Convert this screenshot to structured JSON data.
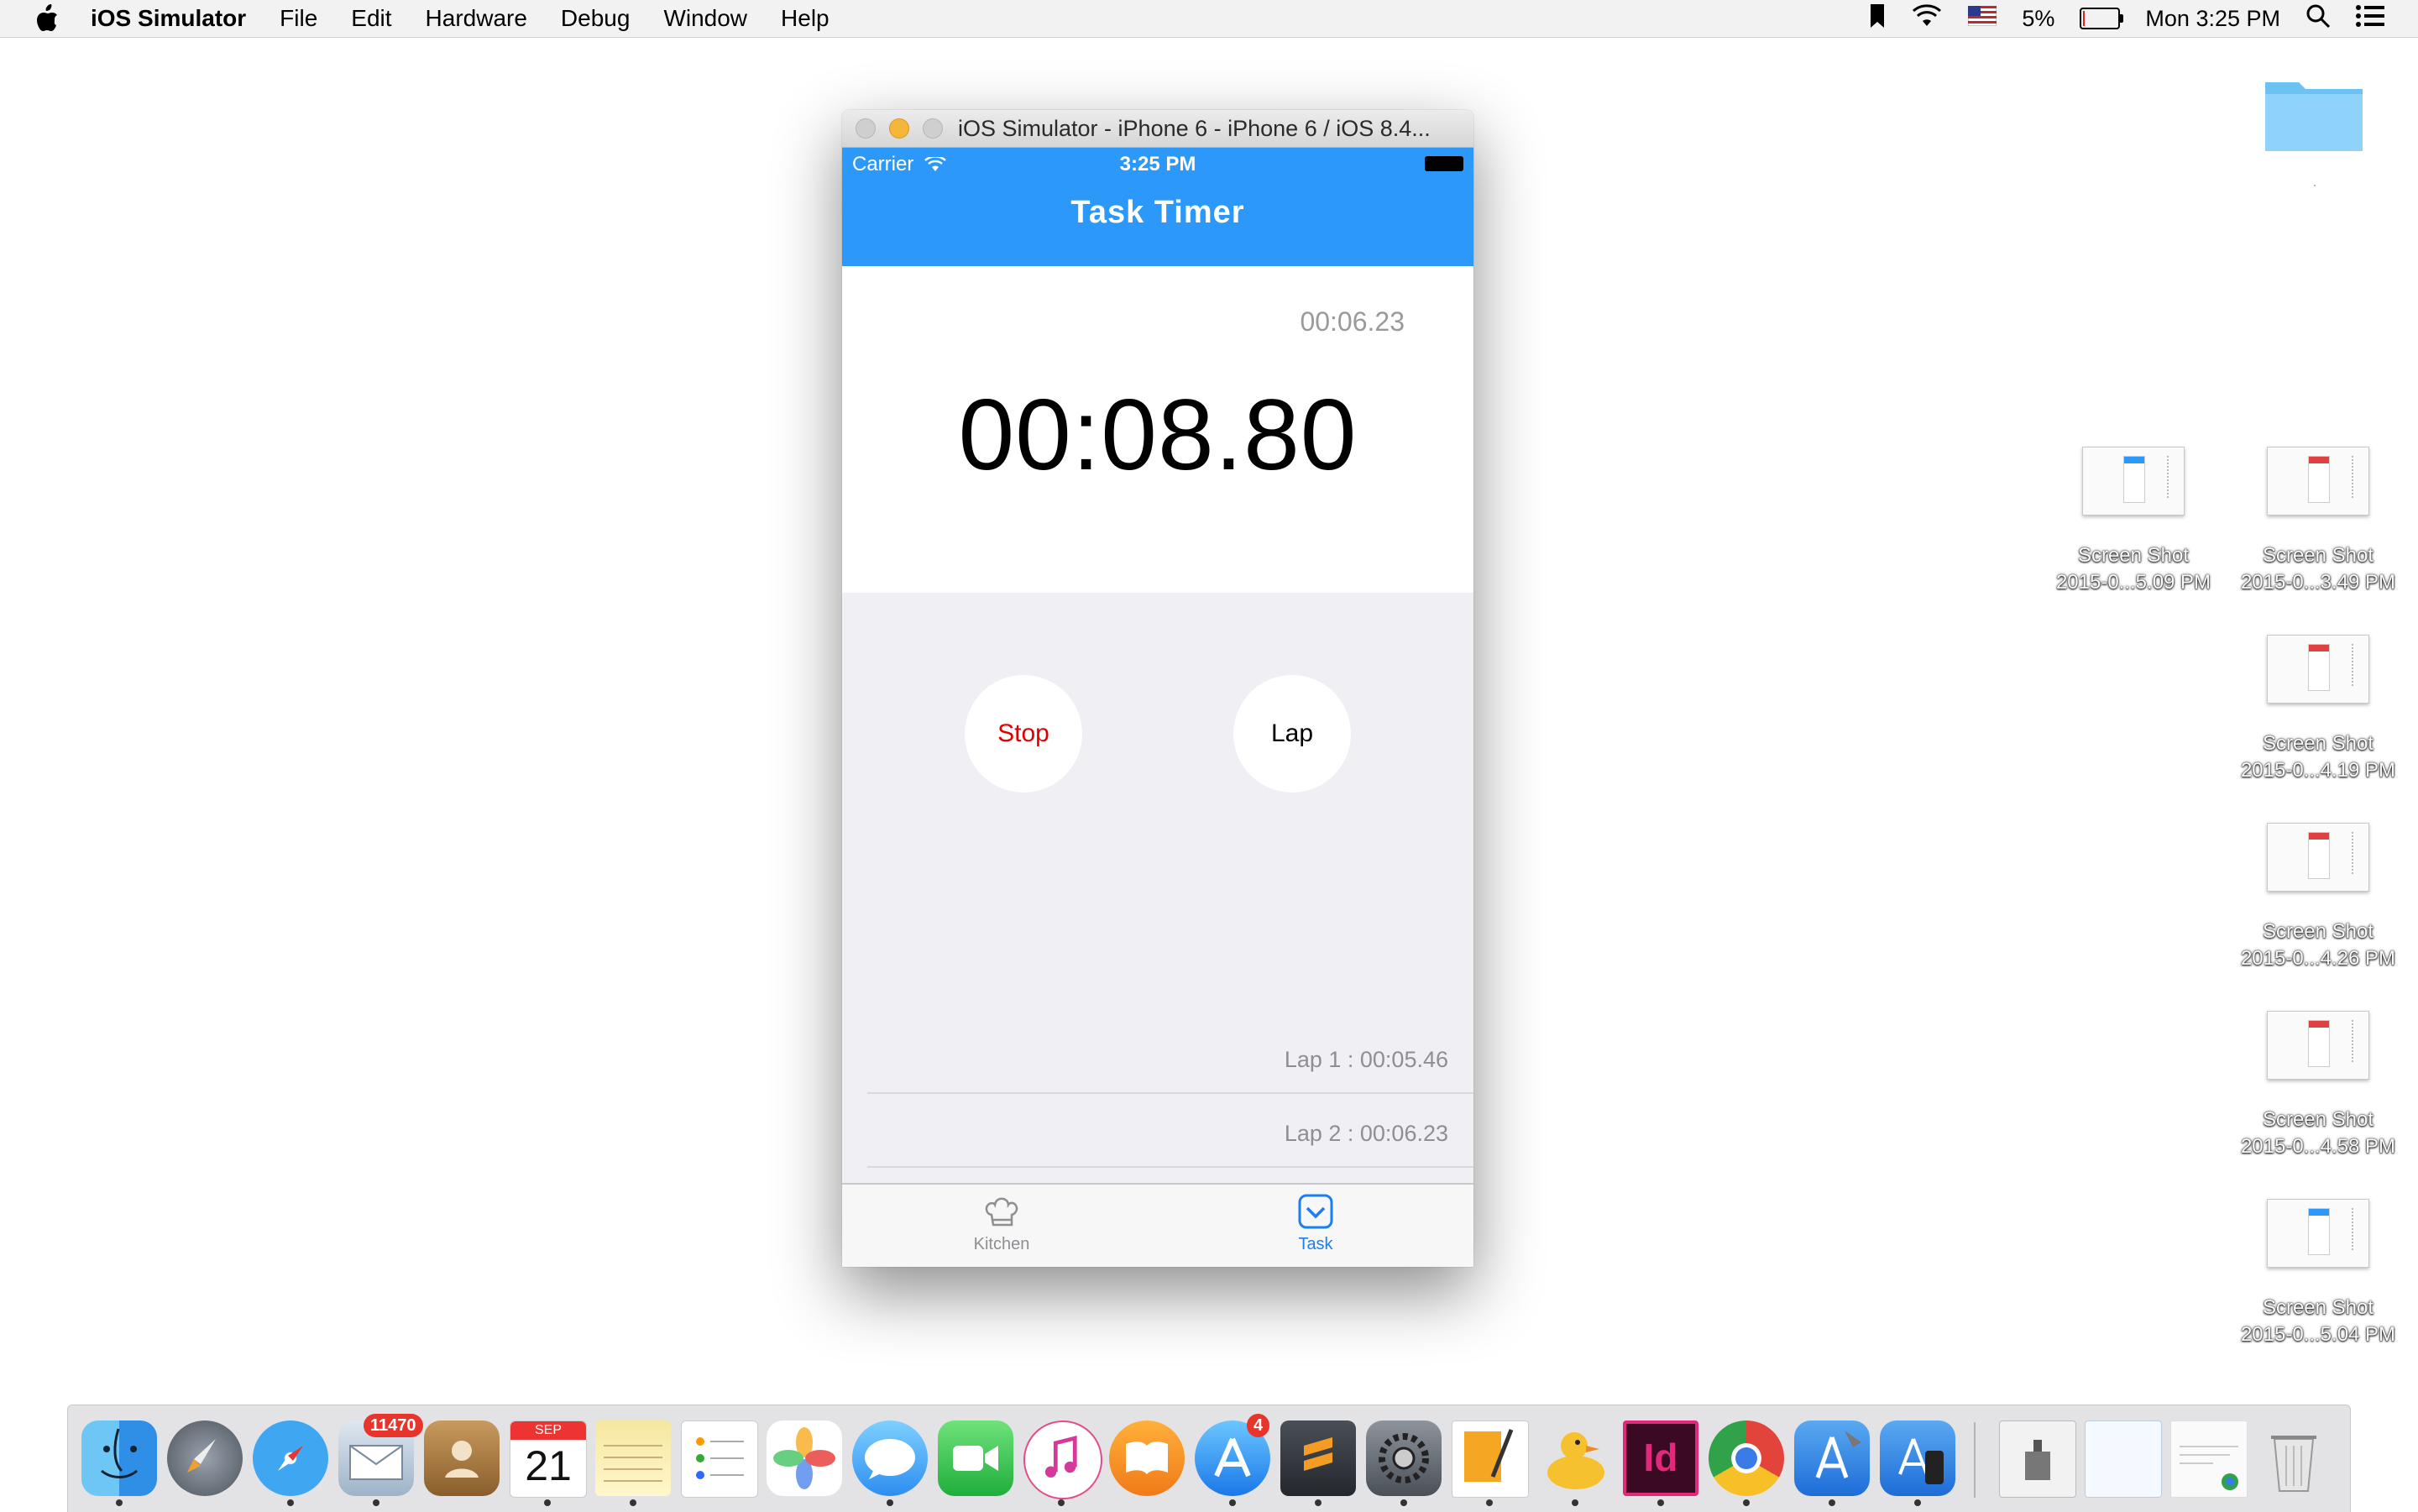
{
  "menubar": {
    "app_name": "iOS Simulator",
    "items": [
      "File",
      "Edit",
      "Hardware",
      "Debug",
      "Window",
      "Help"
    ],
    "battery_percent": "5%",
    "battery_level": 0.05,
    "clock": "Mon 3:25 PM"
  },
  "simulator": {
    "window_title": "iOS Simulator - iPhone 6 - iPhone 6 / iOS 8.4...",
    "status_bar": {
      "carrier": "Carrier",
      "time": "3:25 PM"
    },
    "nav_title": "Task Timer",
    "current_lap_time": "00:06.23",
    "main_time": "00:08.80",
    "buttons": {
      "stop": "Stop",
      "lap": "Lap"
    },
    "laps": [
      "Lap 1 : 00:05.46",
      "Lap 2 : 00:06.23"
    ],
    "tabs": {
      "kitchen": "Kitchen",
      "task": "Task"
    },
    "colors": {
      "nav": "#2c98f9",
      "stop": "#e00000",
      "tab_active": "#1a7ff5"
    }
  },
  "desktop": {
    "files": [
      {
        "line1": "Screen Shot",
        "line2": "2015-0...5.09 PM"
      },
      {
        "line1": "Screen Shot",
        "line2": "2015-0...3.49 PM"
      },
      {
        "line1": "Screen Shot",
        "line2": "2015-0...4.19 PM"
      },
      {
        "line1": "Screen Shot",
        "line2": "2015-0...4.26 PM"
      },
      {
        "line1": "Screen Shot",
        "line2": "2015-0...4.58 PM"
      },
      {
        "line1": "Screen Shot",
        "line2": "2015-0...5.04 PM"
      }
    ]
  },
  "dock": {
    "mail_badge": "11470",
    "appstore_badge": "4",
    "calendar_month": "SEP",
    "calendar_day": "21",
    "apps": [
      "finder-icon",
      "launchpad-icon",
      "safari-icon",
      "mail-icon",
      "contacts-icon",
      "calendar-icon",
      "notes-icon",
      "reminders-icon",
      "photos-icon",
      "messages-icon",
      "facetime-icon",
      "itunes-icon",
      "ibooks-icon",
      "app-store-icon",
      "sublime-text-icon",
      "system-preferences-icon",
      "pages-icon",
      "cyberduck-icon",
      "indesign-icon",
      "chrome-icon",
      "xcode-icon",
      "simulator-icon",
      "archive-utility-icon",
      "document-icon",
      "downloads-stack-icon",
      "trash-icon"
    ]
  }
}
